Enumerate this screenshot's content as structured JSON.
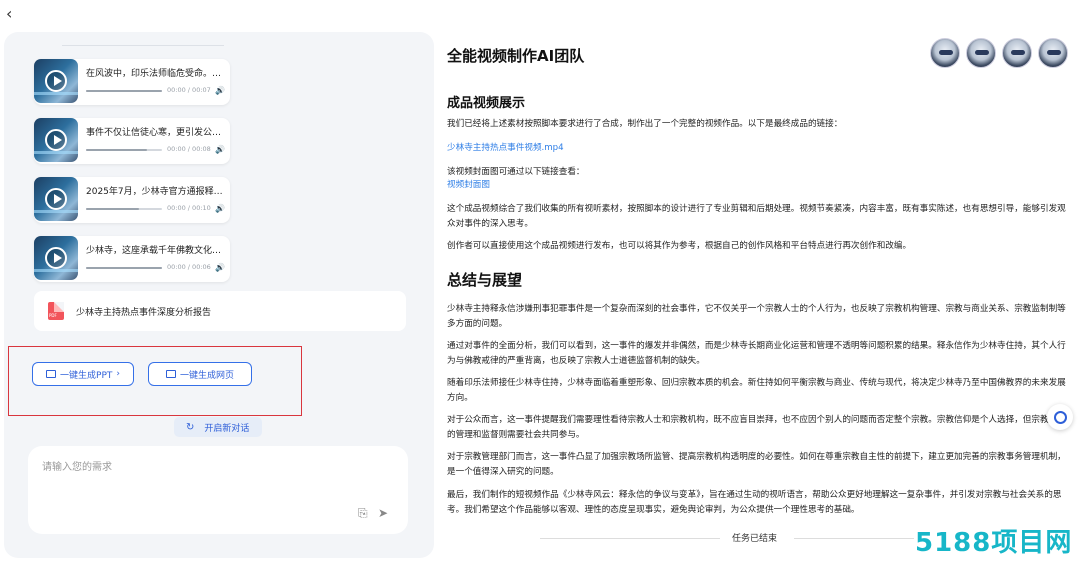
{
  "nav": {
    "back_icon": "chevron-left-icon"
  },
  "videos": [
    {
      "title": "在风波中，印乐法师临危受命。…",
      "time": "00:00 / 00:07",
      "progress": 1.0
    },
    {
      "title": "事件不仅让信徒心寒，更引发公…",
      "time": "00:00 / 00:08",
      "progress": 0.8
    },
    {
      "title": "2025年7月，少林寺官方通报释…",
      "time": "00:00 / 00:10",
      "progress": 0.7
    },
    {
      "title": "少林寺，这座承载千年佛教文化…",
      "time": "00:00 / 00:06",
      "progress": 1.0
    }
  ],
  "report": {
    "label": "少林寺主持热点事件深度分析报告",
    "icon_text": "PDF"
  },
  "actions": {
    "ppt": "一键生成PPT",
    "web": "一键生成网页",
    "new_chat": "开启新对话"
  },
  "input": {
    "placeholder": "请输入您的需求"
  },
  "main": {
    "team_title": "全能视频制作AI团队",
    "section1_title": "成品视频展示",
    "s1_p1": "我们已经将上述素材按照脚本要求进行了合成，制作出了一个完整的视频作品。以下是最终成品的链接：",
    "video_link": "少林寺主持热点事件视频.mp4",
    "cover_intro": "该视频封面图可通过以下链接查看：",
    "cover_link": "视频封面图",
    "s1_p3": "这个成品视频综合了我们收集的所有视听素材，按照脚本的设计进行了专业剪辑和后期处理。视频节奏紧凑，内容丰富，既有事实陈述，也有思想引导，能够引发观众对事件的深入思考。",
    "s1_p4": "创作者可以直接使用这个成品视频进行发布，也可以将其作为参考，根据自己的创作风格和平台特点进行再次创作和改编。",
    "section2_title": "总结与展望",
    "s2_p1": "少林寺主持释永信涉嫌刑事犯罪事件是一个复杂而深刻的社会事件，它不仅关乎一个宗教人士的个人行为，也反映了宗教机构管理、宗教与商业关系、宗教监制制等多方面的问题。",
    "s2_p2": "通过对事件的全面分析，我们可以看到，这一事件的爆发并非偶然，而是少林寺长期商业化运营和管理不透明等问题积累的结果。释永信作为少林寺住持，其个人行为与佛教戒律的严重背离，也反映了宗教人士道德监督机制的缺失。",
    "s2_p3": "随着印乐法师接任少林寺住持，少林寺面临着重塑形象、回归宗教本质的机会。新住持如何平衡宗教与商业、传统与现代，将决定少林寺乃至中国佛教界的未来发展方向。",
    "s2_p4": "对于公众而言，这一事件提醒我们需要理性看待宗教人士和宗教机构，既不应盲目崇拜，也不应因个别人的问题而否定整个宗教。宗教信仰是个人选择，但宗教机构的管理和监督则需要社会共同参与。",
    "s2_p5": "对于宗教管理部门而言，这一事件凸显了加强宗教场所监管、提高宗教机构透明度的必要性。如何在尊重宗教自主性的前提下，建立更加完善的宗教事务管理机制，是一个值得深入研究的问题。",
    "s2_p6": "最后，我们制作的短视频作品《少林寺风云：释永信的争议与变革》，旨在通过生动的视听语言，帮助公众更好地理解这一复杂事件，并引发对宗教与社会关系的思考。我们希望这个作品能够以客观、理性的态度呈现事实，避免舆论审判，为公众提供一个理性思考的基础。",
    "task_ended": "任务已结束"
  },
  "watermark": "5188项目网"
}
